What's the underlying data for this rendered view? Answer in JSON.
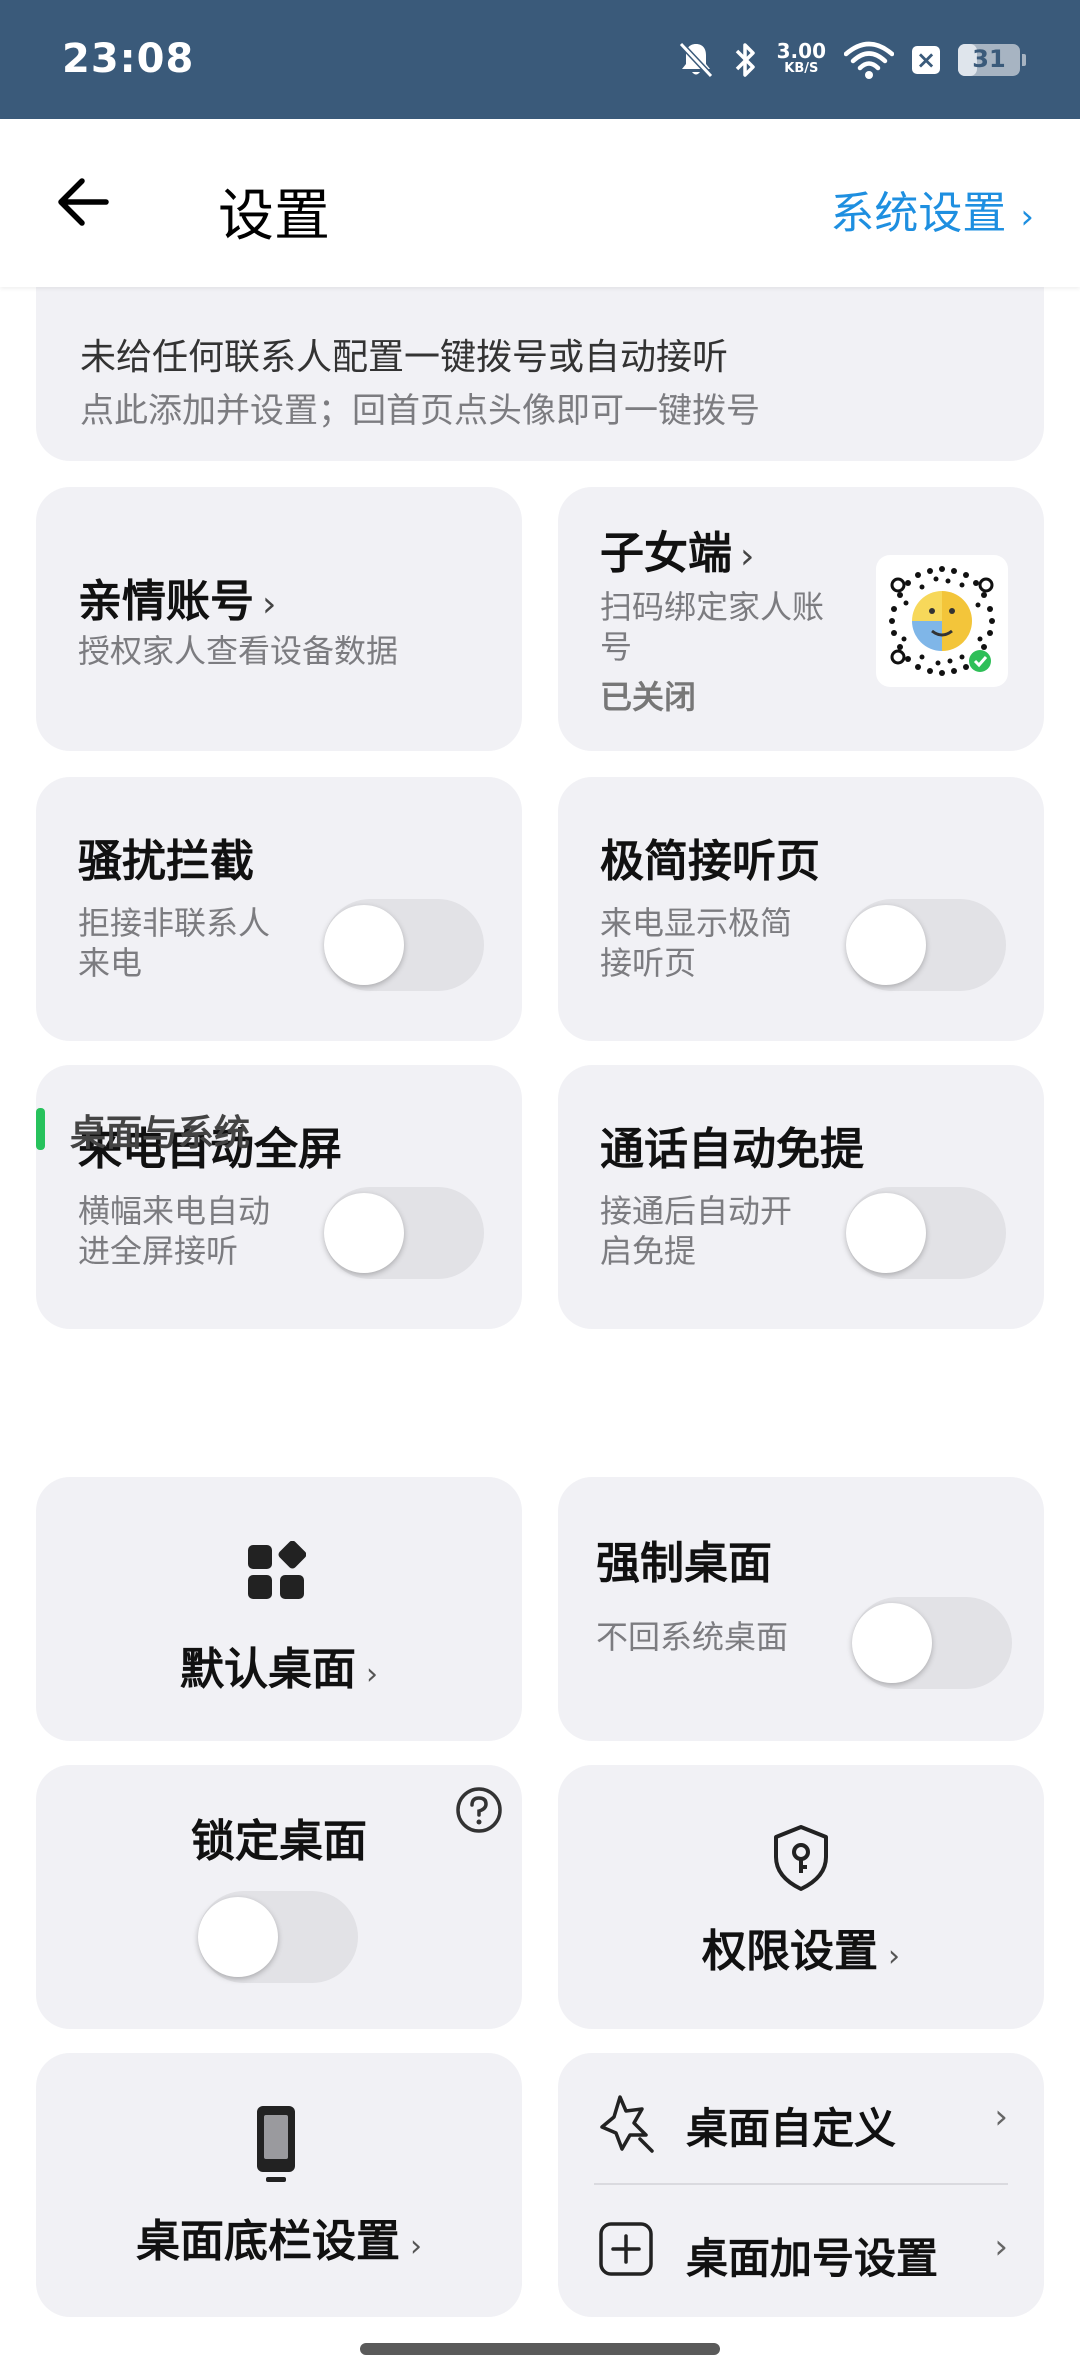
{
  "status_bar": {
    "time": "23:08",
    "net_speed_value": "3.00",
    "net_speed_unit": "KB/S",
    "battery_level": "31",
    "icons": [
      "mute-icon",
      "bluetooth-icon",
      "wifi-icon",
      "close-box-icon",
      "battery-icon"
    ]
  },
  "header": {
    "title": "设置",
    "system_link": "系统设置",
    "back_icon": "arrow-left-icon"
  },
  "cards": {
    "contacts_partial": {
      "line1": "未给任何联系人配置一键拨号或自动接听",
      "line2": "点此添加并设置；回首页点头像即可一键拨号"
    },
    "family_account": {
      "title": "亲情账号",
      "sub": "授权家人查看设备数据"
    },
    "child_end": {
      "title": "子女端",
      "sub1": "扫码绑定家人账",
      "sub2": "号",
      "status": "已关闭"
    },
    "harassment_block": {
      "title": "骚扰拦截",
      "sub1": "拒接非联系人",
      "sub2": "来电",
      "enabled": false
    },
    "simple_answer": {
      "title": "极简接听页",
      "sub1": "来电显示极简",
      "sub2": "接听页",
      "enabled": false
    },
    "auto_fullscreen": {
      "title": "来电自动全屏",
      "sub1": "横幅来电自动",
      "sub2": "进全屏接听",
      "enabled": false
    },
    "auto_handsfree": {
      "title": "通话自动免提",
      "sub1": "接通后自动开",
      "sub2": "启免提",
      "enabled": false
    }
  },
  "section": {
    "title": "桌面与系统"
  },
  "desktop": {
    "default_desktop": {
      "title": "默认桌面"
    },
    "force_desktop": {
      "title": "强制桌面",
      "sub": "不回系统桌面",
      "enabled": false
    },
    "lock_desktop": {
      "title": "锁定桌面",
      "enabled": false
    },
    "permission": {
      "title": "权限设置"
    },
    "dock": {
      "title": "桌面底栏设置"
    },
    "customize": {
      "title": "桌面自定义"
    },
    "plus_settings": {
      "title": "桌面加号设置"
    }
  },
  "colors": {
    "status_bar": "#3a5a7a",
    "link": "#1e8fe0",
    "card": "#f1f1f5",
    "section_accent": "#27c25c"
  }
}
